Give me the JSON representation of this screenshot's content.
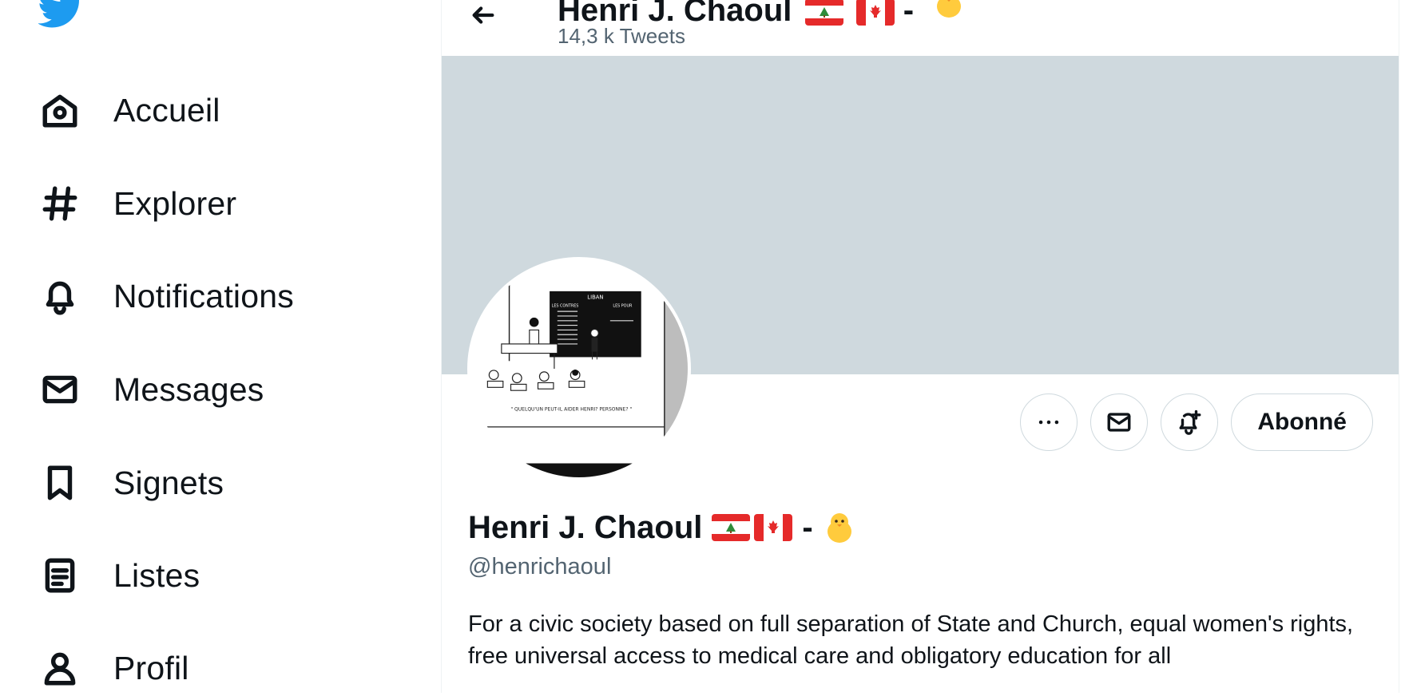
{
  "sidebar": {
    "items": [
      {
        "label": "Accueil",
        "icon": "home-icon"
      },
      {
        "label": "Explorer",
        "icon": "hashtag-icon"
      },
      {
        "label": "Notifications",
        "icon": "bell-icon"
      },
      {
        "label": "Messages",
        "icon": "envelope-icon"
      },
      {
        "label": "Signets",
        "icon": "bookmark-icon"
      },
      {
        "label": "Listes",
        "icon": "list-icon"
      },
      {
        "label": "Profil",
        "icon": "person-icon"
      }
    ]
  },
  "header": {
    "name": "Henri J. Chaoul",
    "tweet_count": "14,3 k Tweets"
  },
  "profile": {
    "display_name": "Henri J. Chaoul",
    "name_suffix": "-",
    "handle": "@henrichaoul",
    "bio": "For a civic society based on full separation of State and Church, equal women's rights, free universal access to medical care and obligatory education for all",
    "follow_label": "Abonné"
  },
  "avatar_cartoon": {
    "board_title": "LIBAN",
    "col_left": "LES CONTRES",
    "col_right": "LES POUR",
    "caption": "\" QUELQU'UN PEUT-IL AIDER HENRI? PERSONNE? \""
  },
  "colors": {
    "brand": "#1d9bf0",
    "banner": "#cfd9de",
    "muted_text": "#536471"
  }
}
